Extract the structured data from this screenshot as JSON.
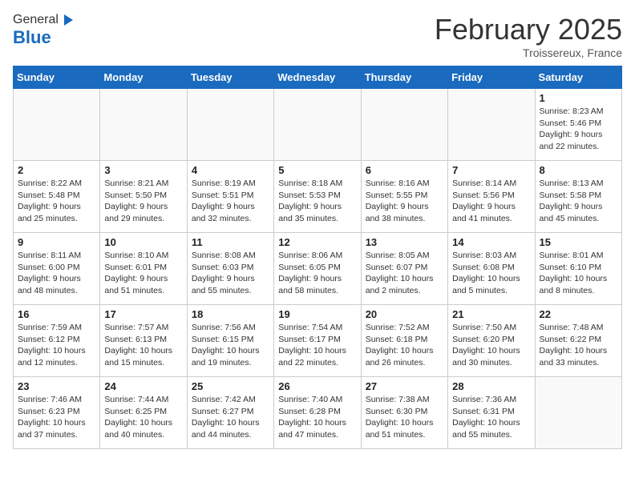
{
  "header": {
    "logo_general": "General",
    "logo_blue": "Blue",
    "month_title": "February 2025",
    "location": "Troissereux, France"
  },
  "days_of_week": [
    "Sunday",
    "Monday",
    "Tuesday",
    "Wednesday",
    "Thursday",
    "Friday",
    "Saturday"
  ],
  "weeks": [
    [
      {
        "day": "",
        "info": ""
      },
      {
        "day": "",
        "info": ""
      },
      {
        "day": "",
        "info": ""
      },
      {
        "day": "",
        "info": ""
      },
      {
        "day": "",
        "info": ""
      },
      {
        "day": "",
        "info": ""
      },
      {
        "day": "1",
        "info": "Sunrise: 8:23 AM\nSunset: 5:46 PM\nDaylight: 9 hours and 22 minutes."
      }
    ],
    [
      {
        "day": "2",
        "info": "Sunrise: 8:22 AM\nSunset: 5:48 PM\nDaylight: 9 hours and 25 minutes."
      },
      {
        "day": "3",
        "info": "Sunrise: 8:21 AM\nSunset: 5:50 PM\nDaylight: 9 hours and 29 minutes."
      },
      {
        "day": "4",
        "info": "Sunrise: 8:19 AM\nSunset: 5:51 PM\nDaylight: 9 hours and 32 minutes."
      },
      {
        "day": "5",
        "info": "Sunrise: 8:18 AM\nSunset: 5:53 PM\nDaylight: 9 hours and 35 minutes."
      },
      {
        "day": "6",
        "info": "Sunrise: 8:16 AM\nSunset: 5:55 PM\nDaylight: 9 hours and 38 minutes."
      },
      {
        "day": "7",
        "info": "Sunrise: 8:14 AM\nSunset: 5:56 PM\nDaylight: 9 hours and 41 minutes."
      },
      {
        "day": "8",
        "info": "Sunrise: 8:13 AM\nSunset: 5:58 PM\nDaylight: 9 hours and 45 minutes."
      }
    ],
    [
      {
        "day": "9",
        "info": "Sunrise: 8:11 AM\nSunset: 6:00 PM\nDaylight: 9 hours and 48 minutes."
      },
      {
        "day": "10",
        "info": "Sunrise: 8:10 AM\nSunset: 6:01 PM\nDaylight: 9 hours and 51 minutes."
      },
      {
        "day": "11",
        "info": "Sunrise: 8:08 AM\nSunset: 6:03 PM\nDaylight: 9 hours and 55 minutes."
      },
      {
        "day": "12",
        "info": "Sunrise: 8:06 AM\nSunset: 6:05 PM\nDaylight: 9 hours and 58 minutes."
      },
      {
        "day": "13",
        "info": "Sunrise: 8:05 AM\nSunset: 6:07 PM\nDaylight: 10 hours and 2 minutes."
      },
      {
        "day": "14",
        "info": "Sunrise: 8:03 AM\nSunset: 6:08 PM\nDaylight: 10 hours and 5 minutes."
      },
      {
        "day": "15",
        "info": "Sunrise: 8:01 AM\nSunset: 6:10 PM\nDaylight: 10 hours and 8 minutes."
      }
    ],
    [
      {
        "day": "16",
        "info": "Sunrise: 7:59 AM\nSunset: 6:12 PM\nDaylight: 10 hours and 12 minutes."
      },
      {
        "day": "17",
        "info": "Sunrise: 7:57 AM\nSunset: 6:13 PM\nDaylight: 10 hours and 15 minutes."
      },
      {
        "day": "18",
        "info": "Sunrise: 7:56 AM\nSunset: 6:15 PM\nDaylight: 10 hours and 19 minutes."
      },
      {
        "day": "19",
        "info": "Sunrise: 7:54 AM\nSunset: 6:17 PM\nDaylight: 10 hours and 22 minutes."
      },
      {
        "day": "20",
        "info": "Sunrise: 7:52 AM\nSunset: 6:18 PM\nDaylight: 10 hours and 26 minutes."
      },
      {
        "day": "21",
        "info": "Sunrise: 7:50 AM\nSunset: 6:20 PM\nDaylight: 10 hours and 30 minutes."
      },
      {
        "day": "22",
        "info": "Sunrise: 7:48 AM\nSunset: 6:22 PM\nDaylight: 10 hours and 33 minutes."
      }
    ],
    [
      {
        "day": "23",
        "info": "Sunrise: 7:46 AM\nSunset: 6:23 PM\nDaylight: 10 hours and 37 minutes."
      },
      {
        "day": "24",
        "info": "Sunrise: 7:44 AM\nSunset: 6:25 PM\nDaylight: 10 hours and 40 minutes."
      },
      {
        "day": "25",
        "info": "Sunrise: 7:42 AM\nSunset: 6:27 PM\nDaylight: 10 hours and 44 minutes."
      },
      {
        "day": "26",
        "info": "Sunrise: 7:40 AM\nSunset: 6:28 PM\nDaylight: 10 hours and 47 minutes."
      },
      {
        "day": "27",
        "info": "Sunrise: 7:38 AM\nSunset: 6:30 PM\nDaylight: 10 hours and 51 minutes."
      },
      {
        "day": "28",
        "info": "Sunrise: 7:36 AM\nSunset: 6:31 PM\nDaylight: 10 hours and 55 minutes."
      },
      {
        "day": "",
        "info": ""
      }
    ]
  ]
}
